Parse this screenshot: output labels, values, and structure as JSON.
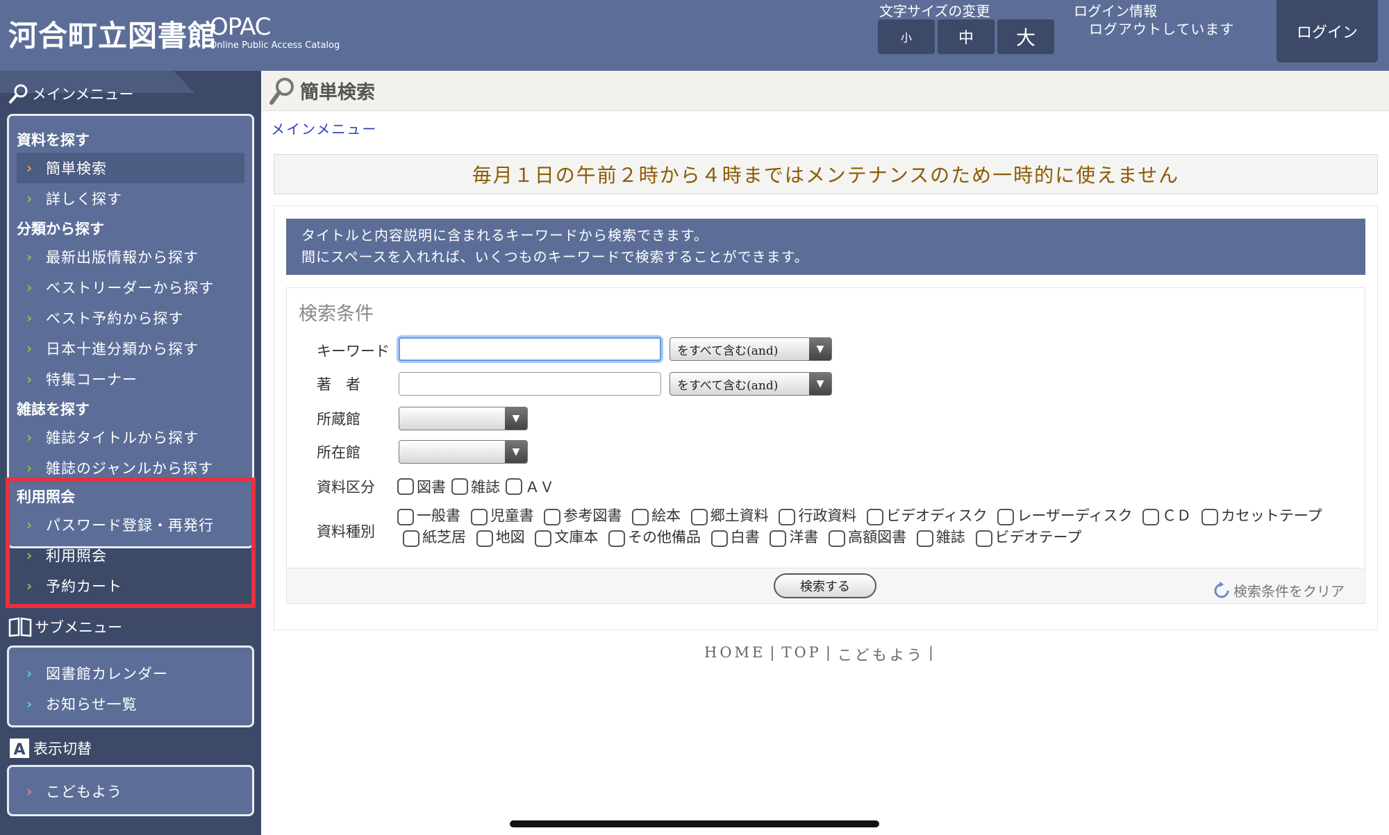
{
  "header": {
    "site_title": "河合町立図書館",
    "opac": "OPAC",
    "opac_sub": "Online Public Access Catalog",
    "font_size_label": "文字サイズの変更",
    "font_small": "小",
    "font_medium": "中",
    "font_large": "大",
    "login_info_label": "ログイン情報",
    "login_status": "ログアウトしています",
    "login_button": "ログイン"
  },
  "sidebar": {
    "main_menu": "メインメニュー",
    "cat_find": "資料を探す",
    "simple_search": "簡単検索",
    "detailed_search": "詳しく探す",
    "cat_classification": "分類から探す",
    "latest_pub": "最新出版情報から探す",
    "best_reader": "ベストリーダーから探す",
    "best_reserve": "ベスト予約から探す",
    "ndc": "日本十進分類から探す",
    "special": "特集コーナー",
    "cat_magazine": "雑誌を探す",
    "mag_title": "雑誌タイトルから探す",
    "mag_genre": "雑誌のジャンルから探す",
    "cat_usage": "利用照会",
    "password": "パスワード登録・再発行",
    "usage": "利用照会",
    "reserve_cart": "予約カート",
    "sub_menu": "サブメニュー",
    "calendar": "図書館カレンダー",
    "news": "お知らせ一覧",
    "display_switch": "表示切替",
    "kids": "こどもよう"
  },
  "main": {
    "page_title": "簡単検索",
    "breadcrumb": "メインメニュー",
    "notice": "毎月１日の午前２時から４時まではメンテナンスのため一時的に使えません",
    "info_line1": "タイトルと内容説明に含まれるキーワードから検索できます。",
    "info_line2": "間にスペースを入れれば、いくつものキーワードで検索することができます。",
    "form_title": "検索条件",
    "label_keyword": "キーワード",
    "label_author": "著　者",
    "label_holding": "所蔵館",
    "label_location": "所在館",
    "label_material_class": "資料区分",
    "label_material_type": "資料種別",
    "keyword_value": "",
    "author_value": "",
    "keyword_mode": "をすべて含む(and)",
    "author_mode": "をすべて含む(and)",
    "holding_value": "",
    "location_value": "",
    "class_book": "図書",
    "class_magazine": "雑誌",
    "class_av": "ＡＶ",
    "types": [
      "一般書",
      "児童書",
      "参考図書",
      "絵本",
      "郷土資料",
      "行政資料",
      "ビデオディスク",
      "レーザーディスク",
      "ＣＤ",
      "カセットテープ",
      "紙芝居",
      "地図",
      "文庫本",
      "その他備品",
      "白書",
      "洋書",
      "高額図書",
      "雑誌",
      "ビデオテープ"
    ],
    "search_button": "検索する",
    "clear_link": "検索条件をクリア"
  },
  "footer": {
    "home": "HOME",
    "top": "TOP",
    "kids": "こどもよう",
    "sep": "|"
  }
}
